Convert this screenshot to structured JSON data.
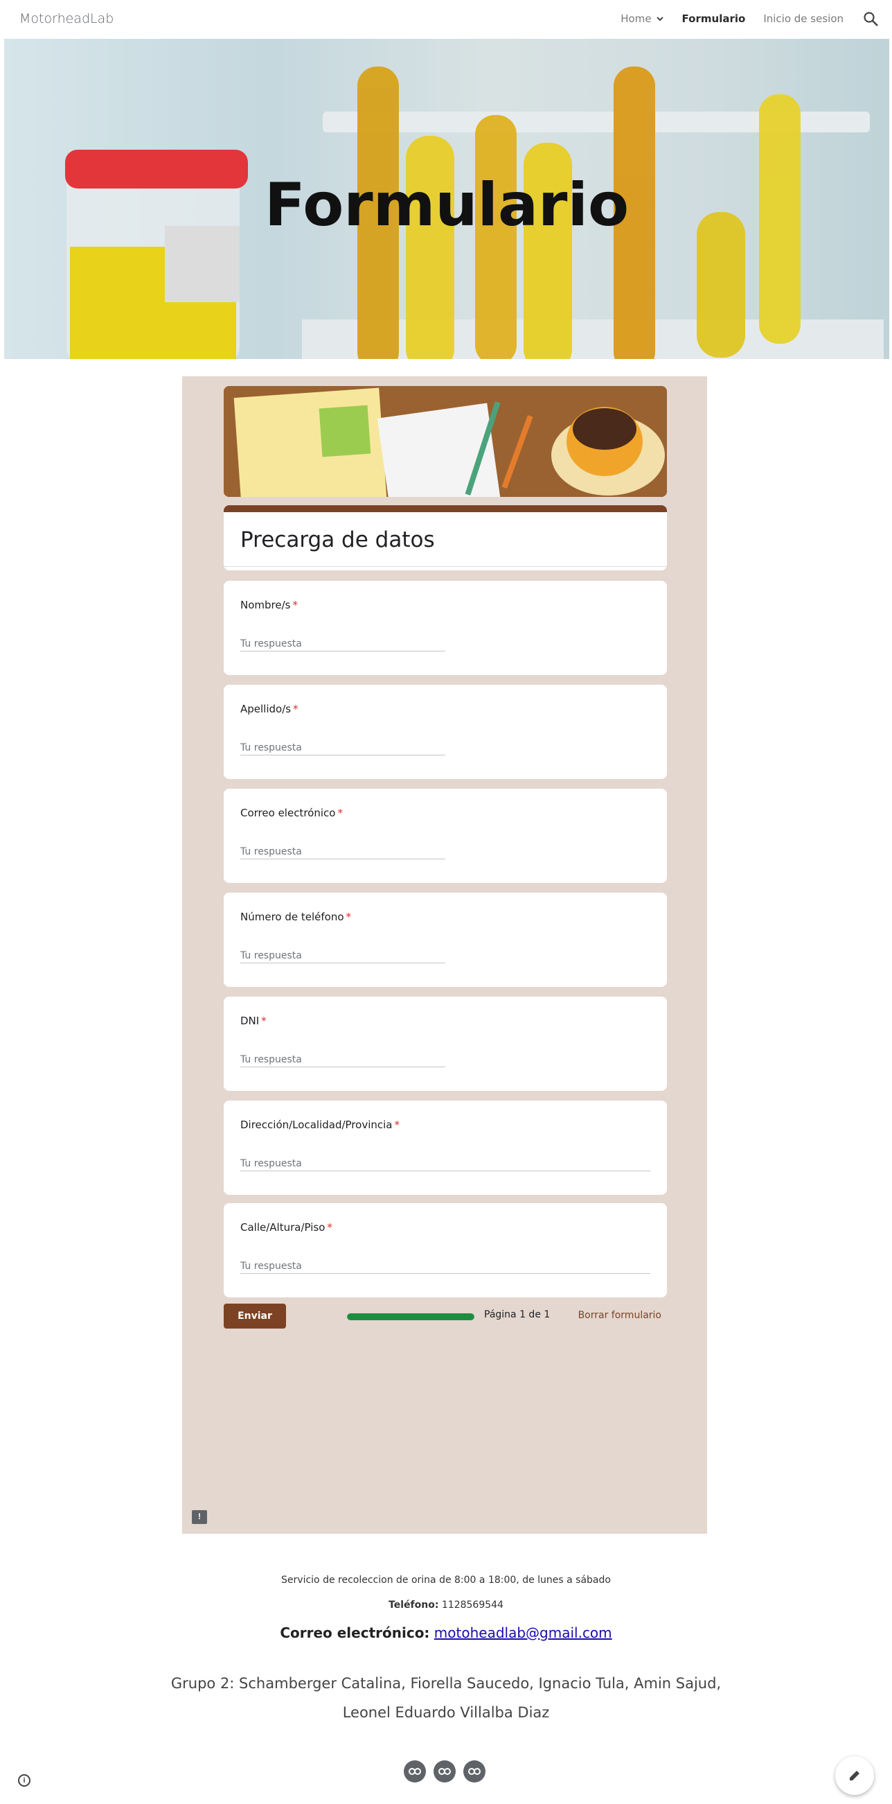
{
  "site": {
    "title": "MotorheadLab"
  },
  "nav": {
    "items": [
      {
        "label": "Home",
        "has_dropdown": true
      },
      {
        "label": "Formulario",
        "active": true
      },
      {
        "label": "Inicio de sesion"
      }
    ],
    "search_icon": "search-icon"
  },
  "hero": {
    "title": "Formulario"
  },
  "form": {
    "title": "Precarga de datos",
    "placeholder": "Tu respuesta",
    "required_mark": "*",
    "questions": [
      {
        "label": "Nombre/s"
      },
      {
        "label": "Apellido/s"
      },
      {
        "label": "Correo electrónico"
      },
      {
        "label": "Número de teléfono"
      },
      {
        "label": "DNI"
      },
      {
        "label": "Dirección/Localidad/Provincia"
      },
      {
        "label": "Calle/Altura/Piso"
      }
    ],
    "submit_label": "Enviar",
    "progress_percent": 100,
    "page_text": "Página 1 de 1",
    "clear_label": "Borrar formulario",
    "accent_color": "#7b4324",
    "background_color": "#e4d7d0"
  },
  "footer": {
    "hours": "Servicio de recoleccion de orina de 8:00 a 18:00, de lunes a sábado",
    "phone_label": "Teléfono:",
    "phone_value": "1128569544",
    "email_label": "Correo electrónico:",
    "email_value": "motoheadlab@gmail.com",
    "group_line1": "Grupo 2:  Schamberger Catalina, Fiorella Saucedo, Ignacio Tula, Amin Sajud,",
    "group_line2": "Leonel Eduardo Villalba Diaz"
  }
}
